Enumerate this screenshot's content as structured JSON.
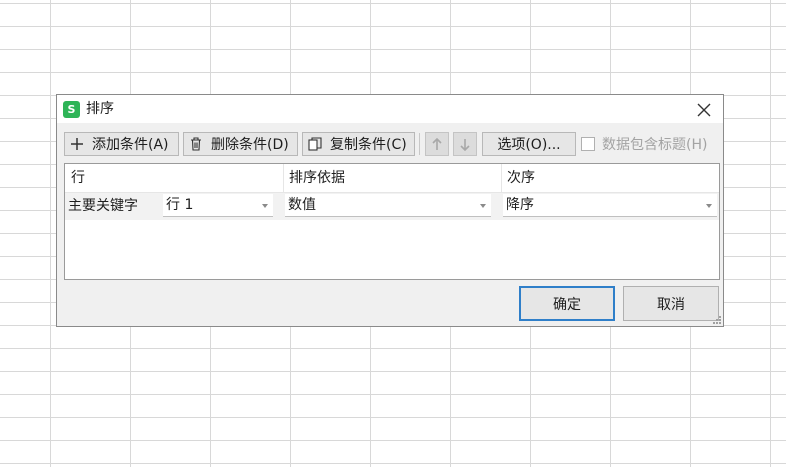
{
  "dialog": {
    "title": "排序",
    "app_icon_letter": "S",
    "accent_color": "#2eb457",
    "focus_color": "#2f7fc9"
  },
  "toolbar": {
    "add_label": "添加条件(A)",
    "delete_label": "删除条件(D)",
    "copy_label": "复制条件(C)",
    "options_label": "选项(O)...",
    "has_header_label": "数据包含标题(H)",
    "has_header_checked": false,
    "move_up_enabled": false,
    "move_down_enabled": false
  },
  "table": {
    "headers": [
      "行",
      "排序依据",
      "次序"
    ],
    "rows": [
      {
        "label": "主要关键字",
        "row": "行 1",
        "sort_on": "数值",
        "order": "降序"
      }
    ]
  },
  "buttons": {
    "ok_label": "确定",
    "cancel_label": "取消"
  }
}
